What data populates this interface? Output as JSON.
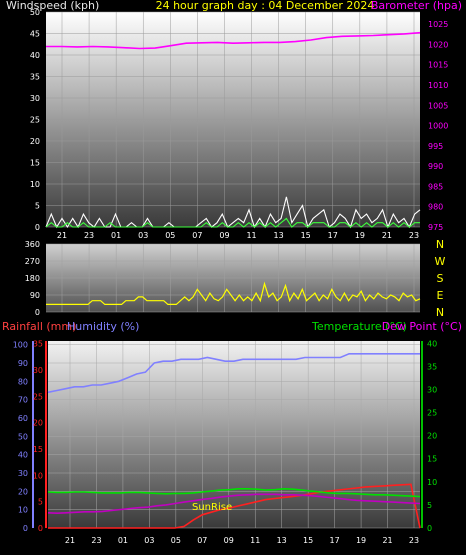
{
  "chart_data": [
    {
      "type": "line",
      "title": "24 hour graph day : 04 December 2024",
      "left_axis_label": "Windspeed (kph)",
      "right_axis_label": "Barometer (hpa)",
      "x_tick_labels": [
        "21",
        "23",
        "01",
        "03",
        "05",
        "07",
        "09",
        "11",
        "13",
        "15",
        "17",
        "19",
        "21",
        "23"
      ],
      "left_ticks": [
        0,
        5,
        10,
        15,
        20,
        25,
        30,
        35,
        40,
        45,
        50
      ],
      "right_ticks": [
        975,
        980,
        985,
        990,
        995,
        1000,
        1005,
        1010,
        1015,
        1020,
        1025
      ],
      "ylim_left": [
        0,
        50
      ],
      "ylim_right": [
        975,
        1028
      ],
      "series": [
        {
          "name": "Barometer (hpa)",
          "axis": "right",
          "color": "#ff00ff",
          "values": [
            1019.5,
            1019.5,
            1019.4,
            1019.5,
            1019.4,
            1019.2,
            1019.0,
            1019.1,
            1019.7,
            1020.3,
            1020.4,
            1020.5,
            1020.3,
            1020.4,
            1020.5,
            1020.5,
            1020.7,
            1021.1,
            1021.7,
            1022.0,
            1022.1,
            1022.2,
            1022.4,
            1022.6,
            1022.9
          ]
        },
        {
          "axis": "left",
          "color": "#ffffff",
          "values": [
            0,
            3,
            0,
            2,
            0,
            2,
            0,
            3,
            1,
            0,
            2,
            0,
            0,
            3,
            0,
            0,
            1,
            0,
            0,
            2,
            0,
            0,
            0,
            1,
            0,
            0,
            0,
            0,
            0,
            1,
            2,
            0,
            1,
            3,
            0,
            1,
            2,
            1,
            4,
            0,
            2,
            0,
            3,
            1,
            2,
            7,
            1,
            3,
            5,
            0,
            2,
            3,
            4,
            0,
            1,
            3,
            2,
            0,
            4,
            2,
            3,
            1,
            2,
            4,
            0,
            3,
            1,
            2,
            0,
            3,
            4
          ]
        },
        {
          "axis": "left",
          "color": "#3cff3c",
          "values": [
            0,
            1,
            0,
            0,
            1,
            0,
            0,
            1,
            0,
            0,
            0,
            0,
            1,
            0,
            0,
            0,
            0,
            0,
            0,
            1,
            0,
            0,
            0,
            0,
            0,
            0,
            0,
            0,
            0,
            0,
            1,
            0,
            0,
            1,
            0,
            0,
            1,
            0,
            1,
            0,
            1,
            0,
            1,
            0,
            1,
            2,
            0,
            1,
            1,
            0,
            1,
            1,
            1,
            0,
            0,
            1,
            1,
            0,
            1,
            0,
            1,
            0,
            1,
            1,
            0,
            1,
            0,
            1,
            0,
            1,
            1
          ]
        }
      ]
    },
    {
      "type": "line",
      "y_ticks": [
        0,
        90,
        180,
        270,
        360
      ],
      "ylim": [
        0,
        360
      ],
      "side_labels": [
        "N",
        "W",
        "S",
        "E",
        "N"
      ],
      "series": [
        {
          "color": "#ffff00",
          "values": [
            40,
            40,
            40,
            40,
            40,
            40,
            40,
            40,
            40,
            40,
            40,
            60,
            60,
            60,
            40,
            40,
            40,
            40,
            40,
            60,
            60,
            60,
            80,
            80,
            60,
            60,
            60,
            60,
            60,
            40,
            40,
            40,
            60,
            80,
            60,
            80,
            120,
            90,
            60,
            100,
            70,
            60,
            80,
            120,
            90,
            60,
            90,
            60,
            80,
            60,
            100,
            60,
            150,
            80,
            100,
            60,
            80,
            140,
            60,
            100,
            70,
            120,
            60,
            80,
            100,
            60,
            90,
            70,
            120,
            80,
            60,
            100,
            60,
            90,
            80,
            110,
            60,
            90,
            70,
            100,
            80,
            70,
            90,
            80,
            60,
            100,
            80,
            90,
            60,
            70
          ]
        }
      ]
    },
    {
      "type": "line",
      "left_axis_label_rain": "Rainfall (mm)",
      "left_axis_label_hum": "Humidity (%)",
      "right_axis_label_temp": "Temperature (°C)",
      "right_axis_label_dew": "Dew Point (°C)",
      "annotation": "SunRise",
      "x_tick_labels": [
        "21",
        "23",
        "01",
        "03",
        "05",
        "07",
        "09",
        "11",
        "13",
        "15",
        "17",
        "19",
        "21",
        "23"
      ],
      "humidity_ticks": [
        0,
        10,
        20,
        30,
        40,
        50,
        60,
        70,
        80,
        90,
        100
      ],
      "rain_ticks": [
        0,
        5,
        10,
        15,
        20,
        25,
        30,
        35
      ],
      "temp_ticks": [
        0,
        5,
        10,
        15,
        20,
        25,
        30,
        35,
        40
      ],
      "ylim_humidity": [
        0,
        102
      ],
      "ylim_rain": [
        0,
        35.5
      ],
      "ylim_temp": [
        0,
        40.5
      ],
      "series": [
        {
          "name": "Humidity (%)",
          "axis": "humidity",
          "color": "#8080ff",
          "values": [
            74,
            75,
            76,
            77,
            77,
            78,
            78,
            79,
            80,
            82,
            84,
            85,
            90,
            91,
            91,
            92,
            92,
            92,
            93,
            92,
            91,
            91,
            92,
            92,
            92,
            92,
            92,
            92,
            92,
            93,
            93,
            93,
            93,
            93,
            95,
            95,
            95,
            95,
            95,
            95,
            95,
            95,
            95
          ]
        },
        {
          "name": "Rainfall (mm)",
          "axis": "rain",
          "color": "#ff2020",
          "values": [
            0,
            0,
            0,
            0,
            0,
            0,
            0,
            0,
            0,
            0,
            0,
            0,
            0,
            0,
            0,
            0.3,
            1.5,
            2.5,
            3.0,
            3.5,
            3.8,
            4.2,
            4.6,
            5.0,
            5.4,
            5.6,
            5.8,
            6.0,
            6.2,
            6.5,
            6.8,
            7.0,
            7.2,
            7.4,
            7.6,
            7.8,
            7.9,
            8.0,
            8.1,
            8.2,
            8.3,
            0
          ]
        },
        {
          "name": "Temperature (°C)",
          "axis": "temp",
          "color": "#00e000",
          "values": [
            7.8,
            7.7,
            7.7,
            7.8,
            7.8,
            7.7,
            7.6,
            7.6,
            7.6,
            7.7,
            7.7,
            7.6,
            7.5,
            7.4,
            7.5,
            7.5,
            7.6,
            7.8,
            8.0,
            8.2,
            8.3,
            8.5,
            8.5,
            8.4,
            8.2,
            8.3,
            8.5,
            8.4,
            8.2,
            8.0,
            7.8,
            7.6,
            7.5,
            7.5,
            7.4,
            7.3,
            7.2,
            7.2,
            7.1,
            7.0,
            6.9,
            6.8
          ]
        },
        {
          "name": "Dew Point (°C)",
          "axis": "temp",
          "color": "#c000c0",
          "values": [
            3.3,
            3.2,
            3.3,
            3.4,
            3.5,
            3.5,
            3.6,
            3.8,
            4.0,
            4.2,
            4.4,
            4.5,
            4.8,
            5.0,
            5.3,
            5.6,
            5.9,
            6.2,
            6.4,
            6.7,
            6.9,
            7.1,
            7.2,
            7.3,
            7.3,
            7.3,
            7.2,
            7.2,
            7.1,
            7.0,
            6.8,
            6.6,
            6.4,
            6.2,
            6.0,
            5.9,
            5.8,
            5.7,
            5.6,
            5.5,
            5.4,
            5.3
          ]
        }
      ]
    }
  ]
}
